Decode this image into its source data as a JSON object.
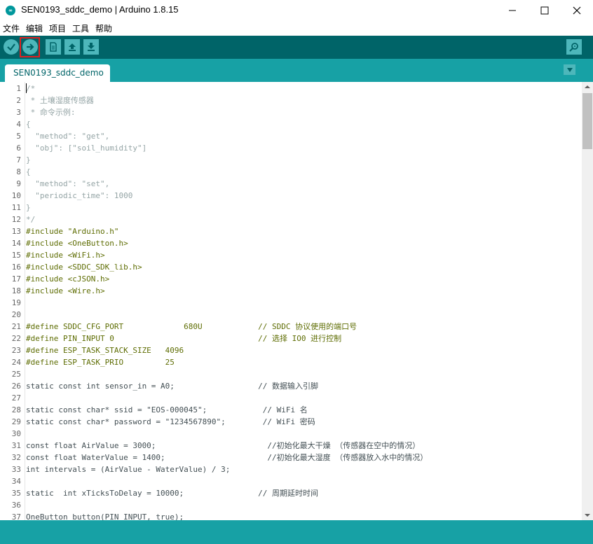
{
  "window": {
    "title": "SEN0193_sddc_demo | Arduino 1.8.15",
    "app_icon": "arduino-icon"
  },
  "window_controls": {
    "minimize": "minimize-icon",
    "maximize": "maximize-icon",
    "close": "close-icon"
  },
  "menu": [
    "文件",
    "编辑",
    "项目",
    "工具",
    "帮助"
  ],
  "toolbar": {
    "verify": "verify-icon",
    "upload": "upload-icon",
    "new": "new-icon",
    "open": "open-icon",
    "save": "save-icon",
    "serial_monitor": "serial-monitor-icon"
  },
  "tab": {
    "label": "SEN0193_sddc_demo",
    "menu_icon": "tab-menu-icon"
  },
  "colors": {
    "toolbar": "#006468",
    "tabbar": "#17a1a5",
    "button": "#4db7bb",
    "comment": "#95a5a6",
    "keyword": "#00979c",
    "string": "#005c5f",
    "highlight_border": "#e02020"
  },
  "code_lines": [
    {
      "n": "1",
      "t": "/*"
    },
    {
      "n": "2",
      "t": " * 土壤湿度传感器"
    },
    {
      "n": "3",
      "t": " * 命令示例:"
    },
    {
      "n": "4",
      "t": "{"
    },
    {
      "n": "5",
      "t": "  \"method\": \"get\","
    },
    {
      "n": "6",
      "t": "  \"obj\": [\"soil_humidity\"]"
    },
    {
      "n": "7",
      "t": "}"
    },
    {
      "n": "8",
      "t": "{"
    },
    {
      "n": "9",
      "t": "  \"method\": \"set\","
    },
    {
      "n": "10",
      "t": "  \"periodic_time\": 1000"
    },
    {
      "n": "11",
      "t": "}"
    },
    {
      "n": "12",
      "t": "*/"
    },
    {
      "n": "13",
      "t": "#include \"Arduino.h\""
    },
    {
      "n": "14",
      "t": "#include <OneButton.h>"
    },
    {
      "n": "15",
      "t": "#include <WiFi.h>"
    },
    {
      "n": "16",
      "t": "#include <SDDC_SDK_lib.h>"
    },
    {
      "n": "17",
      "t": "#include <cJSON.h>"
    },
    {
      "n": "18",
      "t": "#include <Wire.h>"
    },
    {
      "n": "19",
      "t": ""
    },
    {
      "n": "20",
      "t": ""
    },
    {
      "n": "21",
      "t": "#define SDDC_CFG_PORT             680U            // SDDC 协议使用的端口号"
    },
    {
      "n": "22",
      "t": "#define PIN_INPUT 0                               // 选择 IO0 进行控制"
    },
    {
      "n": "23",
      "t": "#define ESP_TASK_STACK_SIZE   4096"
    },
    {
      "n": "24",
      "t": "#define ESP_TASK_PRIO         25"
    },
    {
      "n": "25",
      "t": ""
    },
    {
      "n": "26",
      "t": "static const int sensor_in = A0;                  // 数据输入引脚"
    },
    {
      "n": "27",
      "t": ""
    },
    {
      "n": "28",
      "t": "static const char* ssid = \"EOS-000045\";            // WiFi 名"
    },
    {
      "n": "29",
      "t": "static const char* password = \"1234567890\";        // WiFi 密码"
    },
    {
      "n": "30",
      "t": ""
    },
    {
      "n": "31",
      "t": "const float AirValue = 3000;                        //初始化最大干燥 （传感器在空中的情况）"
    },
    {
      "n": "32",
      "t": "const float WaterValue = 1400;                      //初始化最大湿度 （传感器放入水中的情况）"
    },
    {
      "n": "33",
      "t": "int intervals = (AirValue - WaterValue) / 3;"
    },
    {
      "n": "34",
      "t": ""
    },
    {
      "n": "35",
      "t": "static  int xTicksToDelay = 10000;                // 周期延时时间"
    },
    {
      "n": "36",
      "t": ""
    },
    {
      "n": "37",
      "t": "OneButton button(PIN_INPUT, true);"
    }
  ]
}
